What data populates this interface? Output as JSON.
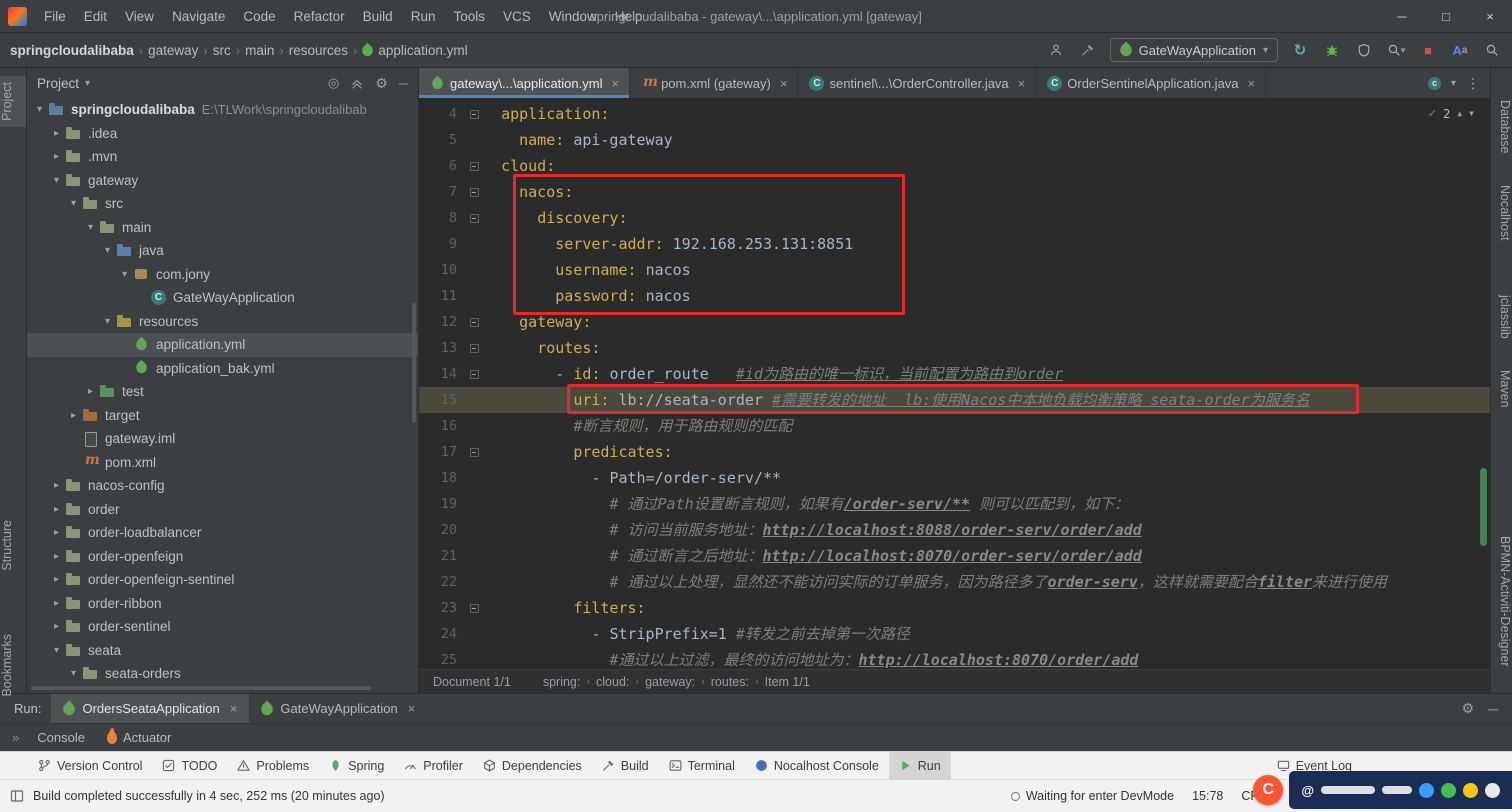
{
  "icons": {
    "minimize": "─",
    "maximize": "□",
    "close": "×",
    "chevron_down": "▾",
    "crumb_sep": "›",
    "tree_expanded": "▾",
    "tree_collapsed": "▸",
    "more": "⋮",
    "gear": "⚙",
    "hide": "─",
    "locate": "◎",
    "collapse_all": "⇑",
    "rerun": "↻",
    "stop": "■",
    "check": "✓",
    "arrow_up": "▲",
    "arrow_down": "▼",
    "chevrons": "»"
  },
  "window": {
    "title": "springcloudalibaba - gateway\\...\\application.yml [gateway]",
    "menus": [
      "File",
      "Edit",
      "View",
      "Navigate",
      "Code",
      "Refactor",
      "Build",
      "Run",
      "Tools",
      "VCS",
      "Window",
      "Help"
    ]
  },
  "navbar": {
    "breadcrumbs": [
      {
        "label": "springcloudalibaba",
        "bold": true
      },
      {
        "label": "gateway"
      },
      {
        "label": "src"
      },
      {
        "label": "main"
      },
      {
        "label": "resources"
      },
      {
        "label": "application.yml",
        "icon": "leaf"
      }
    ],
    "run_config": "GateWayApplication"
  },
  "left_strip": {
    "project": "Project",
    "structure": "Structure",
    "bookmarks": "Bookmarks"
  },
  "right_strip": {
    "items": [
      "Database",
      "Nocalhost",
      "jclasslib",
      "Maven",
      "BPMN-Activiti-Designer"
    ]
  },
  "project_panel": {
    "title": "Project",
    "tree": [
      {
        "d": 0,
        "c": "e",
        "i": "module",
        "l": "springcloudalibaba",
        "x": "E:\\TLWork\\springcloudalibab",
        "b": true
      },
      {
        "d": 1,
        "c": "c",
        "i": "folder",
        "l": ".idea"
      },
      {
        "d": 1,
        "c": "c",
        "i": "folder",
        "l": ".mvn"
      },
      {
        "d": 1,
        "c": "e",
        "i": "folder",
        "l": "gateway"
      },
      {
        "d": 2,
        "c": "e",
        "i": "folder",
        "l": "src"
      },
      {
        "d": 3,
        "c": "e",
        "i": "folder",
        "l": "main"
      },
      {
        "d": 4,
        "c": "e",
        "i": "srcfolder",
        "l": "java"
      },
      {
        "d": 5,
        "c": "e",
        "i": "pkg",
        "l": "com.jony"
      },
      {
        "d": 6,
        "c": "n",
        "i": "classic",
        "l": "GateWayApplication"
      },
      {
        "d": 4,
        "c": "e",
        "i": "resfolder",
        "l": "resources"
      },
      {
        "d": 5,
        "c": "n",
        "i": "leafic",
        "l": "application.yml",
        "sel": true
      },
      {
        "d": 5,
        "c": "n",
        "i": "leafic",
        "l": "application_bak.yml"
      },
      {
        "d": 3,
        "c": "c",
        "i": "testfolder",
        "l": "test"
      },
      {
        "d": 2,
        "c": "c",
        "i": "excluded",
        "l": "target"
      },
      {
        "d": 2,
        "c": "n",
        "i": "fileic",
        "l": "gateway.iml"
      },
      {
        "d": 2,
        "c": "n",
        "i": "mavenic",
        "l": "pom.xml"
      },
      {
        "d": 1,
        "c": "c",
        "i": "folder",
        "l": "nacos-config"
      },
      {
        "d": 1,
        "c": "c",
        "i": "folder",
        "l": "order"
      },
      {
        "d": 1,
        "c": "c",
        "i": "folder",
        "l": "order-loadbalancer"
      },
      {
        "d": 1,
        "c": "c",
        "i": "folder",
        "l": "order-openfeign"
      },
      {
        "d": 1,
        "c": "c",
        "i": "folder",
        "l": "order-openfeign-sentinel"
      },
      {
        "d": 1,
        "c": "c",
        "i": "folder",
        "l": "order-ribbon"
      },
      {
        "d": 1,
        "c": "c",
        "i": "folder",
        "l": "order-sentinel"
      },
      {
        "d": 1,
        "c": "e",
        "i": "folder",
        "l": "seata"
      },
      {
        "d": 2,
        "c": "e",
        "i": "folder",
        "l": "seata-orders"
      }
    ]
  },
  "editor": {
    "tabs": [
      {
        "icon": "leafic",
        "label": "gateway\\...\\application.yml",
        "active": true
      },
      {
        "icon": "mavenic",
        "label": "pom.xml (gateway)"
      },
      {
        "icon": "classic",
        "label": "sentinel\\...\\OrderController.java"
      },
      {
        "icon": "classic",
        "label": "OrderSentinelApplication.java"
      }
    ],
    "inspections": {
      "count": "2"
    },
    "lines": [
      {
        "n": 4,
        "f": true,
        "s": [
          [
            "  ",
            "p"
          ],
          [
            "application:",
            "k"
          ]
        ]
      },
      {
        "n": 5,
        "f": false,
        "s": [
          [
            "    ",
            "p"
          ],
          [
            "name:",
            "k"
          ],
          [
            " ",
            "p"
          ],
          [
            "api-gateway",
            "v"
          ]
        ]
      },
      {
        "n": 6,
        "f": true,
        "s": [
          [
            "  ",
            "p"
          ],
          [
            "cloud:",
            "k"
          ]
        ]
      },
      {
        "n": 7,
        "f": true,
        "s": [
          [
            "    ",
            "p"
          ],
          [
            "nacos:",
            "k"
          ]
        ]
      },
      {
        "n": 8,
        "f": true,
        "s": [
          [
            "      ",
            "p"
          ],
          [
            "discovery:",
            "k"
          ]
        ]
      },
      {
        "n": 9,
        "f": false,
        "s": [
          [
            "        ",
            "p"
          ],
          [
            "server-addr:",
            "k"
          ],
          [
            " ",
            "p"
          ],
          [
            "192.168.253.131:8851",
            "v"
          ]
        ]
      },
      {
        "n": 10,
        "f": false,
        "s": [
          [
            "        ",
            "p"
          ],
          [
            "username:",
            "k"
          ],
          [
            " ",
            "p"
          ],
          [
            "nacos",
            "v"
          ]
        ]
      },
      {
        "n": 11,
        "f": false,
        "s": [
          [
            "        ",
            "p"
          ],
          [
            "password:",
            "k"
          ],
          [
            " ",
            "p"
          ],
          [
            "nacos",
            "v"
          ]
        ]
      },
      {
        "n": 12,
        "f": true,
        "s": [
          [
            "    ",
            "p"
          ],
          [
            "gateway:",
            "k"
          ]
        ]
      },
      {
        "n": 13,
        "f": true,
        "s": [
          [
            "      ",
            "p"
          ],
          [
            "routes:",
            "k"
          ]
        ]
      },
      {
        "n": 14,
        "f": true,
        "s": [
          [
            "        ",
            "p"
          ],
          [
            "- ",
            "d"
          ],
          [
            "id:",
            "k"
          ],
          [
            " ",
            "p"
          ],
          [
            "order_route",
            "v"
          ],
          [
            "   ",
            "p"
          ],
          [
            "#id为路由的唯一标识，当前配置为路由到order",
            "cu"
          ]
        ]
      },
      {
        "n": 15,
        "f": false,
        "h": true,
        "s": [
          [
            "          ",
            "p"
          ],
          [
            "uri:",
            "k"
          ],
          [
            " ",
            "p"
          ],
          [
            "lb://seata-order",
            "v"
          ],
          [
            " ",
            "p"
          ],
          [
            "#需要转发的地址  lb:使用Nacos中本地负载均衡策略 seata-order为服务名",
            "cu"
          ]
        ]
      },
      {
        "n": 16,
        "f": false,
        "s": [
          [
            "          ",
            "p"
          ],
          [
            "#断言规则，用于路由规则的匹配",
            "c"
          ]
        ]
      },
      {
        "n": 17,
        "f": true,
        "s": [
          [
            "          ",
            "p"
          ],
          [
            "predicates:",
            "k"
          ]
        ]
      },
      {
        "n": 18,
        "f": false,
        "s": [
          [
            "            ",
            "p"
          ],
          [
            "- ",
            "d"
          ],
          [
            "Path=/order-serv/**",
            "v"
          ]
        ]
      },
      {
        "n": 19,
        "f": false,
        "s": [
          [
            "              ",
            "p"
          ],
          [
            "# 通过Path设置断言规则，如果有",
            "c"
          ],
          [
            "/order-serv/**",
            "u"
          ],
          [
            " 则可以匹配到，如下：",
            "c"
          ]
        ]
      },
      {
        "n": 20,
        "f": false,
        "s": [
          [
            "              ",
            "p"
          ],
          [
            "# 访问当前服务地址：",
            "c"
          ],
          [
            "http://localhost:8088/order-serv/order/add",
            "u"
          ]
        ]
      },
      {
        "n": 21,
        "f": false,
        "s": [
          [
            "              ",
            "p"
          ],
          [
            "# 通过断言之后地址：",
            "c"
          ],
          [
            "http://localhost:8070/order-serv/order/add",
            "u"
          ]
        ]
      },
      {
        "n": 22,
        "f": false,
        "s": [
          [
            "              ",
            "p"
          ],
          [
            "# 通过以上处理，显然还不能访问实际的订单服务，因为路径多了",
            "c"
          ],
          [
            "order-serv",
            "u"
          ],
          [
            "，这样就需要配合",
            "c"
          ],
          [
            "filter",
            "u"
          ],
          [
            "来进行使用",
            "c"
          ]
        ]
      },
      {
        "n": 23,
        "f": true,
        "s": [
          [
            "          ",
            "p"
          ],
          [
            "filters:",
            "k"
          ]
        ]
      },
      {
        "n": 24,
        "f": false,
        "s": [
          [
            "            ",
            "p"
          ],
          [
            "- ",
            "d"
          ],
          [
            "StripPrefix=1",
            "v"
          ],
          [
            " ",
            "p"
          ],
          [
            "#转发之前去掉第一次路径",
            "c"
          ]
        ]
      },
      {
        "n": 25,
        "f": false,
        "s": [
          [
            "              ",
            "p"
          ],
          [
            "#通过以上过滤，最终的访问地址为：",
            "c"
          ],
          [
            "http://localhost:8070/order/add",
            "u"
          ]
        ]
      }
    ],
    "breadcrumbs": {
      "doc": "Document 1/1",
      "path": [
        "spring:",
        "cloud:",
        "gateway:",
        "routes:",
        "Item 1/1"
      ]
    }
  },
  "run_panel": {
    "label": "Run:",
    "tabs": [
      {
        "label": "OrdersSeataApplication",
        "active": true
      },
      {
        "label": "GateWayApplication"
      }
    ],
    "subtabs": [
      {
        "label": "Console"
      },
      {
        "label": "Actuator",
        "icon": "flame"
      }
    ]
  },
  "bottom_bar": {
    "items": [
      {
        "id": "version-control",
        "icon": "branch",
        "label": "Version Control"
      },
      {
        "id": "todo",
        "icon": "todo",
        "label": "TODO"
      },
      {
        "id": "problems",
        "icon": "problems",
        "label": "Problems"
      },
      {
        "id": "spring",
        "icon": "spring",
        "label": "Spring"
      },
      {
        "id": "profiler",
        "icon": "profiler",
        "label": "Profiler"
      },
      {
        "id": "dependencies",
        "icon": "dependencies",
        "label": "Dependencies"
      },
      {
        "id": "build",
        "icon": "build",
        "label": "Build"
      },
      {
        "id": "terminal",
        "icon": "terminal",
        "label": "Terminal"
      },
      {
        "id": "nocalhost",
        "icon": "nocalhost",
        "label": "Nocalhost Console"
      },
      {
        "id": "run",
        "icon": "run",
        "label": "Run",
        "active": true
      }
    ],
    "right": {
      "id": "event-log",
      "icon": "eventlog",
      "label": "Event Log"
    }
  },
  "status_bar": {
    "message": "Build completed successfully in 4 sec, 252 ms (20 minutes ago)",
    "devmode": "Waiting for enter DevMode",
    "caret": "15:78",
    "line_sep": "CRLF"
  },
  "watermark": {
    "handle": "@"
  }
}
